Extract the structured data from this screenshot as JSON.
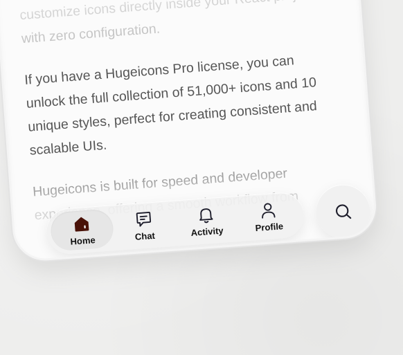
{
  "content": {
    "paragraphs": [
      "customize icons directly inside your React project with zero configuration.",
      "If you have a Hugeicons Pro license, you can unlock the full collection of 51,000+ icons and 10 unique styles, perfect for creating consistent and scalable UIs.",
      "Hugeicons is built for speed and developer experience, offering a smooth workflow from"
    ]
  },
  "navbar": {
    "items": [
      {
        "label": "Home",
        "icon": "home-icon",
        "active": true
      },
      {
        "label": "Chat",
        "icon": "chat-icon",
        "active": false
      },
      {
        "label": "Activity",
        "icon": "bell-icon",
        "active": false
      },
      {
        "label": "Profile",
        "icon": "user-icon",
        "active": false
      }
    ]
  },
  "search": {
    "icon": "search-icon"
  },
  "colors": {
    "active_icon": "#4a1208",
    "icon": "#1d1d2b",
    "text": "#555555"
  }
}
